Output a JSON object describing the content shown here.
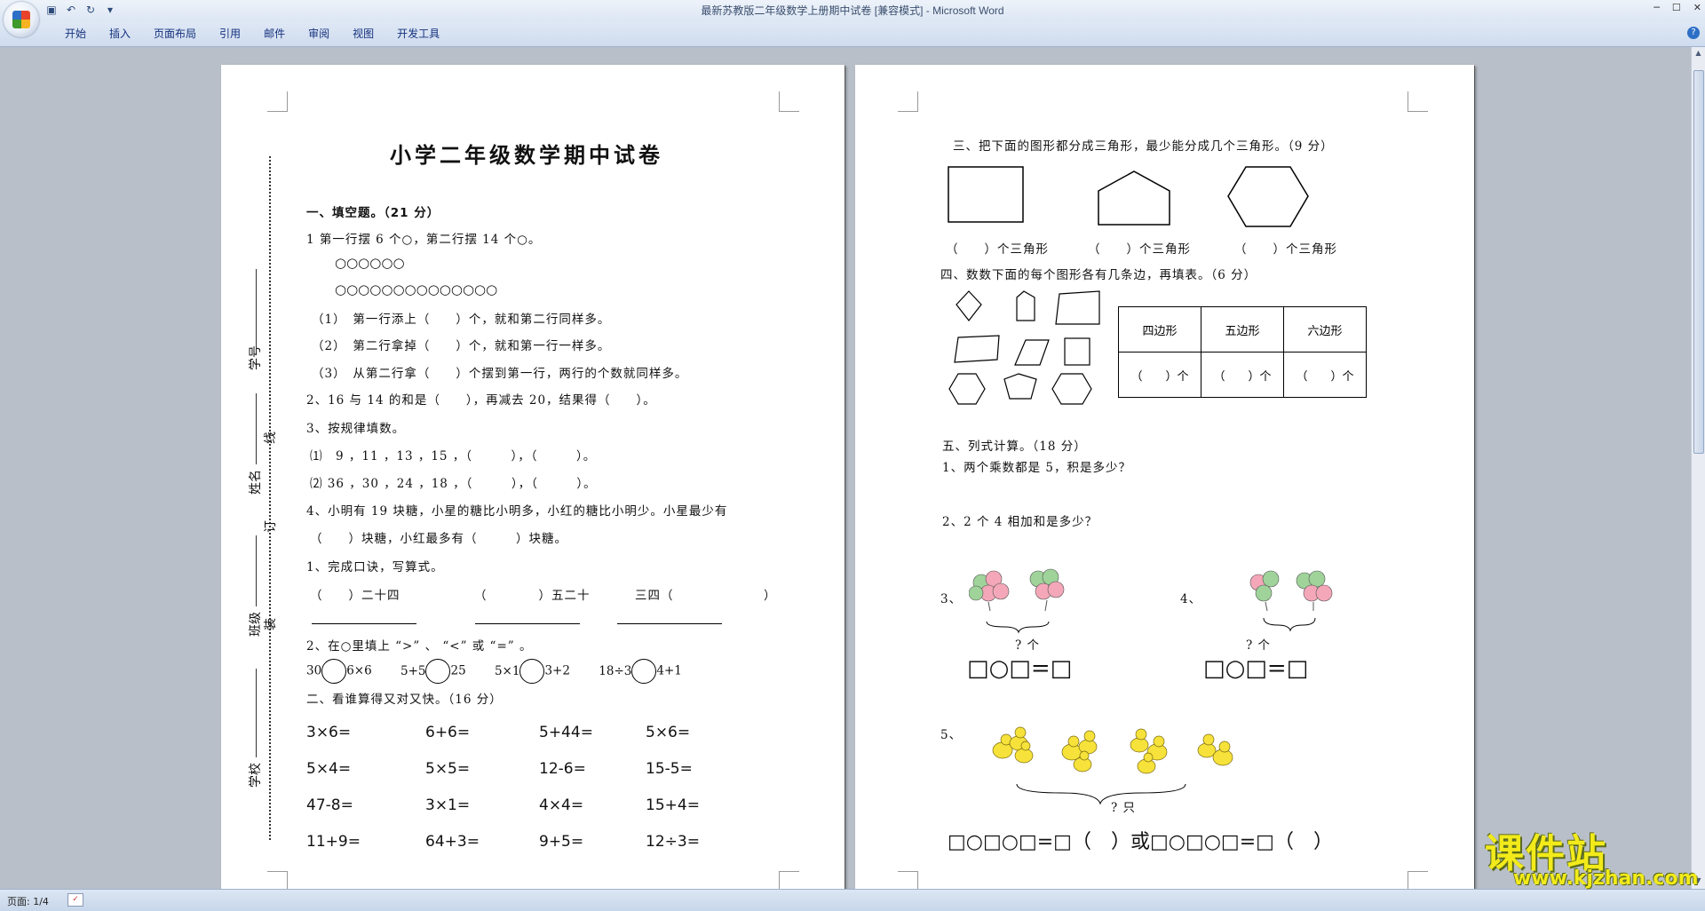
{
  "window": {
    "title": "最新苏教版二年级数学上册期中试卷 [兼容模式] - Microsoft Word"
  },
  "qat": {
    "save_icon": "save-icon",
    "undo_icon": "undo-icon",
    "redo_icon": "redo-icon",
    "customize": "▾"
  },
  "ribbon": {
    "tabs": [
      "开始",
      "插入",
      "页面布局",
      "引用",
      "邮件",
      "审阅",
      "视图",
      "开发工具"
    ]
  },
  "statusbar": {
    "page": "页面: 1/4"
  },
  "page1": {
    "title": "小学二年级数学期中试卷",
    "binding": {
      "student_no": "学号",
      "name": "姓名",
      "class": "班级",
      "school": "学校",
      "line": "线",
      "ding": "订",
      "zhuang": "装"
    },
    "s1_head": "一、填空题。（21 分）",
    "q1": "1 第一行摆 6 个○，第二行摆 14 个○。",
    "row1": "○○○○○○",
    "row2": "○○○○○○○○○○○○○○",
    "q1_1": "（1）　第一行添上（　　）个，就和第二行同样多。",
    "q1_2": "（2）　第二行拿掉（　　）个，就和第一行一样多。",
    "q1_3": "（3）　从第二行拿（　　）个摆到第一行，两行的个数就同样多。",
    "q2": "2、16 与 14 的和是（　　），再减去 20，结果得（　　）。",
    "q3": "3、按规律填数。",
    "q3_1": "⑴　9 ，11 ，13 ，15 ，（　　　），（　　　）。",
    "q3_2": "⑵ 36 ，30 ，24 ，18 ，（　　　），（　　　）。",
    "q4a": "4、小明有 19 块糖，小星的糖比小明多，小红的糖比小明少。小星最少有",
    "q4b": "（　　）块糖，小红最多有（　　　）块糖。",
    "q5": "1、完成口诀，写算式。",
    "q5_a": "（　　）二十四",
    "q5_b": "（　　　　）五二十",
    "q5_c": "三四（　　　　　　　）",
    "q6": "2、在○里填上 “>” 、 “<” 或 “=” 。",
    "cmp": [
      "30",
      "6×6",
      "5+5",
      "25",
      "5×1",
      "3+2",
      "18÷3",
      "4+1"
    ],
    "s2_head": "二、看谁算得又对又快。（16 分）",
    "calc": [
      [
        "3×6=",
        "6+6=",
        "5+44=",
        "5×6="
      ],
      [
        "5×4=",
        "5×5=",
        "12-6=",
        "15-5="
      ],
      [
        "47-8=",
        "3×1=",
        "4×4=",
        "15+4="
      ],
      [
        "11+9=",
        "64+3=",
        "9+5=",
        "12÷3="
      ]
    ]
  },
  "page2": {
    "s3_head": "三、把下面的图形都分成三角形，最少能分成几个三角形。（9 分）",
    "s3_ans": [
      "（　　）个三角形",
      "（　　）个三角形",
      "（　　）个三角形"
    ],
    "s4_head": "四、数数下面的每个图形各有几条边，再填表。（6 分）",
    "table_head": [
      "四边形",
      "五边形",
      "六边形"
    ],
    "table_row": [
      "（　　）个",
      "（　　）个",
      "（　　）个"
    ],
    "s5_head": "五、列式计算。（18 分）",
    "s5_q1": "1、两个乘数都是 5，积是多少？",
    "s5_q2": "2、2 个 4 相加和是多少？",
    "q3_label": "3、",
    "q4_label": "4、",
    "q5_label": "5、",
    "how_many": "? 个",
    "how_many_zhi": "? 只",
    "eq_small": "□○□=□",
    "eq_big_a": "□○□○□=□（　）或□○□○□=□（　）"
  },
  "watermark": {
    "brand": "课件站",
    "url": "www.kjzhan.com"
  }
}
